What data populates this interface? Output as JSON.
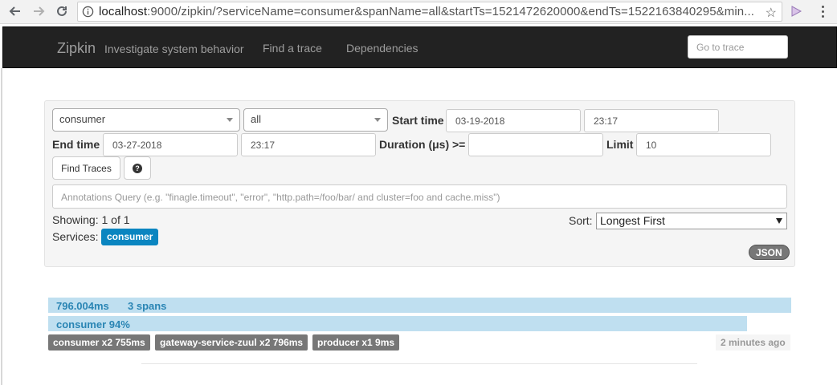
{
  "browser": {
    "url_host": "localhost",
    "url_rest": ":9000/zipkin/?serviceName=consumer&spanName=all&startTs=1521472620000&endTs=1522163840295&min..."
  },
  "navbar": {
    "brand": "Zipkin",
    "tagline": "Investigate system behavior",
    "links": [
      "Find a trace",
      "Dependencies"
    ],
    "goto_placeholder": "Go to trace"
  },
  "search": {
    "service": "consumer",
    "span": "all",
    "start_time_label": "Start time",
    "start_date": "03-19-2018",
    "start_clock": "23:17",
    "end_time_label": "End time",
    "end_date": "03-27-2018",
    "end_clock": "23:17",
    "duration_label": "Duration (μs) >=",
    "duration_value": "",
    "limit_label": "Limit",
    "limit_value": "10",
    "find_button": "Find Traces",
    "help_icon": "?",
    "annotations_placeholder": "Annotations Query (e.g. \"finagle.timeout\", \"error\", \"http.path=/foo/bar/ and cluster=foo and cache.miss\")",
    "showing": "Showing: 1 of 1",
    "services_label": "Services:",
    "services_badge": "consumer",
    "sort_label": "Sort:",
    "sort_value": "Longest First",
    "json_button": "JSON"
  },
  "trace": {
    "duration": "796.004ms",
    "spans": "3 spans",
    "service_pct": "consumer 94%",
    "services": [
      "consumer x2 755ms",
      "gateway-service-zuul x2 796ms",
      "producer x1 9ms"
    ],
    "time_ago": "2 minutes ago"
  },
  "colors": {
    "navbar_bg": "#222222",
    "trace_bar": "#bfdff0",
    "service_badge": "#0a85c0",
    "span_badge": "#777777"
  }
}
